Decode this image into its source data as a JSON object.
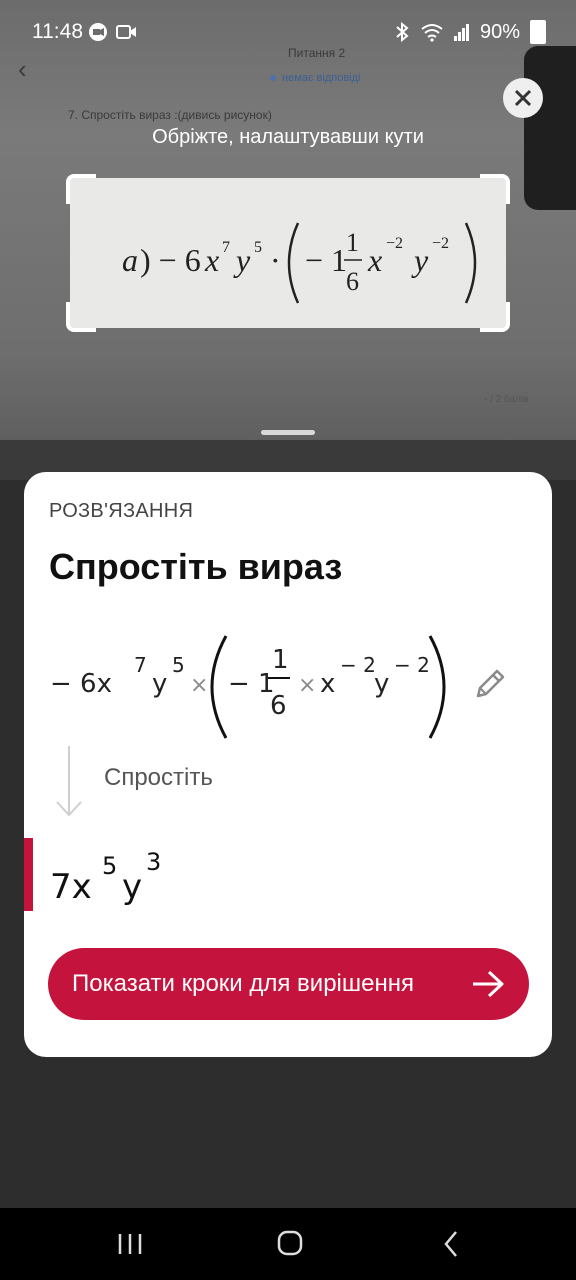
{
  "status_bar": {
    "time": "11:48",
    "battery": "90%"
  },
  "background_page": {
    "question": "Питання 2",
    "status": "немає відповіді",
    "prompt": "7. Спростіть вираз :(дивись рисунок)",
    "score": "- / 2 балів"
  },
  "crop": {
    "hint": "Обріжте, налаштувавши кути"
  },
  "solution": {
    "section_label": "РОЗВ'ЯЗАННЯ",
    "title": "Спростіть вираз",
    "step_label": "Спростіть",
    "button_label": "Показати кроки для вирішення"
  },
  "expression": {
    "input": "− 6x^7 y^5 × ( − 1 1/6 × x^−2 y^−2 )",
    "result": "7x^5 y^3"
  },
  "colors": {
    "accent": "#c4133c",
    "card_bg": "#ffffff",
    "screen_bg": "#2d2d2d"
  },
  "icons": {
    "back": "chevron-left-icon",
    "close": "close-icon",
    "edit": "pencil-icon",
    "step": "arrow-down-icon",
    "button": "arrow-right-icon"
  }
}
